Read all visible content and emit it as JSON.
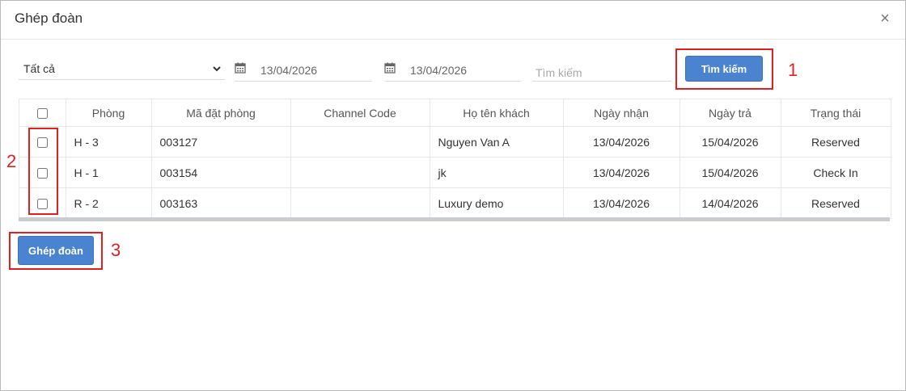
{
  "modal": {
    "title": "Ghép đoàn",
    "close_symbol": "×"
  },
  "filters": {
    "status_select": "Tất cả",
    "date_from": "13/04/2026",
    "date_to": "13/04/2026",
    "search_placeholder": "Tìm kiếm",
    "search_button": "Tìm kiếm"
  },
  "table": {
    "headers": [
      "Phòng",
      "Mã đặt phòng",
      "Channel Code",
      "Họ tên khách",
      "Ngày nhận",
      "Ngày trả",
      "Trạng thái"
    ],
    "rows": [
      {
        "room": "H - 3",
        "booking_code": "003127",
        "channel_code": "",
        "guest_name": "Nguyen Van A",
        "check_in": "13/04/2026",
        "check_out": "15/04/2026",
        "status": "Reserved"
      },
      {
        "room": "H - 1",
        "booking_code": "003154",
        "channel_code": "",
        "guest_name": "jk",
        "check_in": "13/04/2026",
        "check_out": "15/04/2026",
        "status": "Check In"
      },
      {
        "room": "R - 2",
        "booking_code": "003163",
        "channel_code": "",
        "guest_name": "Luxury demo",
        "check_in": "13/04/2026",
        "check_out": "14/04/2026",
        "status": "Reserved"
      }
    ]
  },
  "actions": {
    "merge_button": "Ghép đoàn"
  },
  "annotations": {
    "one": "1",
    "two": "2",
    "three": "3"
  },
  "colors": {
    "primary": "#4a83cf",
    "annotation": "#e32020"
  }
}
